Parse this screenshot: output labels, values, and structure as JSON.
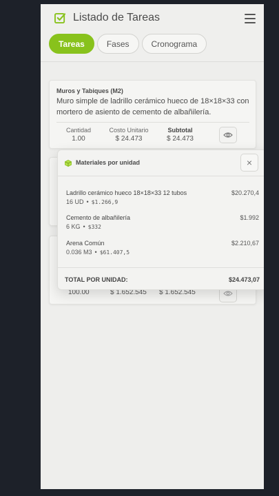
{
  "header": {
    "title": "Listado de Tareas",
    "check_icon": "check-square-icon",
    "menu_icon": "hamburger-menu-icon",
    "accent": "#88c21c"
  },
  "tabs": [
    {
      "label": "Tareas",
      "active": true
    },
    {
      "label": "Fases",
      "active": false
    },
    {
      "label": "Cronograma",
      "active": false
    }
  ],
  "tasks": [
    {
      "category": "Muros y Tabiques (M2)",
      "description": "Muro simple de ladrillo cerámico hueco de 18×18×33 con mortero de asiento de cemento de albañilería.",
      "labels": {
        "qty": "Cantidad",
        "unit": "Costo Unitario",
        "subtotal": "Subtotal"
      },
      "qty": "1.00",
      "unit_cost": "$ 24.473",
      "subtotal": "$ 24.473"
    },
    {
      "qty": "100.00",
      "unit_cost": "$ 1.652.545",
      "subtotal": "$ 1.652.545"
    }
  ],
  "popover": {
    "title": "Materiales por unidad",
    "icon": "cube-icon",
    "close": "×",
    "materials": [
      {
        "name": "Ladrillo cerámico hueco 18×18×33 12 tubos",
        "price": "$20.270,4",
        "qty": "16 UD",
        "unit_price": "$1.266,9"
      },
      {
        "name": "Cemento de albañilería",
        "price": "$1.992",
        "qty": "6 KG",
        "unit_price": "$332"
      },
      {
        "name": "Arena Común",
        "price": "$2.210,67",
        "qty": "0.036 M3",
        "unit_price": "$61.407,5"
      }
    ],
    "total_label": "TOTAL POR UNIDAD:",
    "total_value": "$24.473,07",
    "separator": "•"
  }
}
